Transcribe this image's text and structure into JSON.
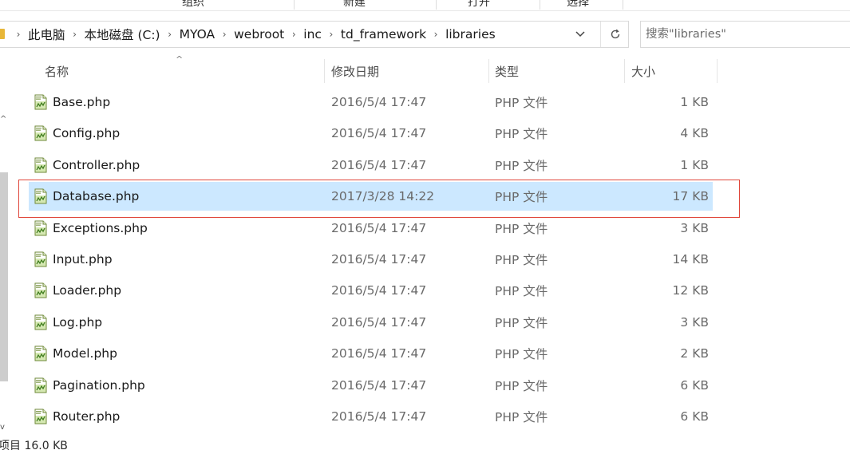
{
  "ribbon": {
    "groups": [
      "组织",
      "新建",
      "打开",
      "选择"
    ]
  },
  "address": {
    "crumbs": [
      "此电脑",
      "本地磁盘 (C:)",
      "MYOA",
      "webroot",
      "inc",
      "td_framework",
      "libraries"
    ]
  },
  "search": {
    "placeholder": "搜索\"libraries\""
  },
  "columns": {
    "name": "名称",
    "date": "修改日期",
    "type": "类型",
    "size": "大小"
  },
  "files": [
    {
      "name": "Base.php",
      "date": "2016/5/4 17:47",
      "type": "PHP 文件",
      "size": "1 KB"
    },
    {
      "name": "Config.php",
      "date": "2016/5/4 17:47",
      "type": "PHP 文件",
      "size": "4 KB"
    },
    {
      "name": "Controller.php",
      "date": "2016/5/4 17:47",
      "type": "PHP 文件",
      "size": "1 KB"
    },
    {
      "name": "Database.php",
      "date": "2017/3/28 14:22",
      "type": "PHP 文件",
      "size": "17 KB",
      "selected": true
    },
    {
      "name": "Exceptions.php",
      "date": "2016/5/4 17:47",
      "type": "PHP 文件",
      "size": "3 KB"
    },
    {
      "name": "Input.php",
      "date": "2016/5/4 17:47",
      "type": "PHP 文件",
      "size": "14 KB"
    },
    {
      "name": "Loader.php",
      "date": "2016/5/4 17:47",
      "type": "PHP 文件",
      "size": "12 KB"
    },
    {
      "name": "Log.php",
      "date": "2016/5/4 17:47",
      "type": "PHP 文件",
      "size": "3 KB"
    },
    {
      "name": "Model.php",
      "date": "2016/5/4 17:47",
      "type": "PHP 文件",
      "size": "2 KB"
    },
    {
      "name": "Pagination.php",
      "date": "2016/5/4 17:47",
      "type": "PHP 文件",
      "size": "6 KB"
    },
    {
      "name": "Router.php",
      "date": "2016/5/4 17:47",
      "type": "PHP 文件",
      "size": "6 KB"
    }
  ],
  "status": {
    "text": "项目  16.0 KB"
  },
  "colors": {
    "selection": "#cce8ff",
    "highlight_border": "#e0463a",
    "folder": "#e8b739"
  },
  "icons": {
    "file": "php-file-icon",
    "dropdown": "chevron-down-icon",
    "refresh": "refresh-icon",
    "folder": "folder-icon"
  }
}
